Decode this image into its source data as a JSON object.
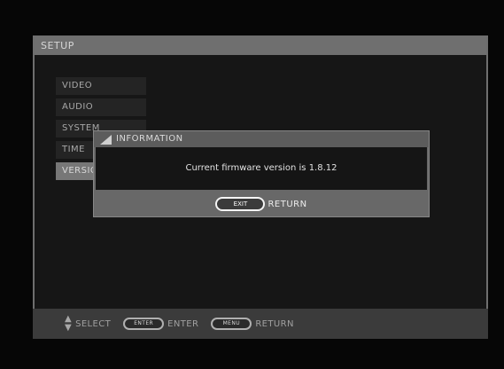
{
  "setup": {
    "title": "SETUP",
    "menu_items": [
      {
        "label": "VIDEO"
      },
      {
        "label": "AUDIO"
      },
      {
        "label": "SYSTEM"
      },
      {
        "label": "TIME"
      },
      {
        "label": "VERSION"
      }
    ]
  },
  "information_dialog": {
    "title": "INFORMATION",
    "message": "Current firmware version is 1.8.12",
    "return_button_key": "EXIT",
    "return_label": "RETURN"
  },
  "bottom_bar": {
    "select_label": "SELECT",
    "enter_key": "ENTER",
    "enter_label": "ENTER",
    "return_key": "MENU",
    "return_label": "RETURN"
  }
}
